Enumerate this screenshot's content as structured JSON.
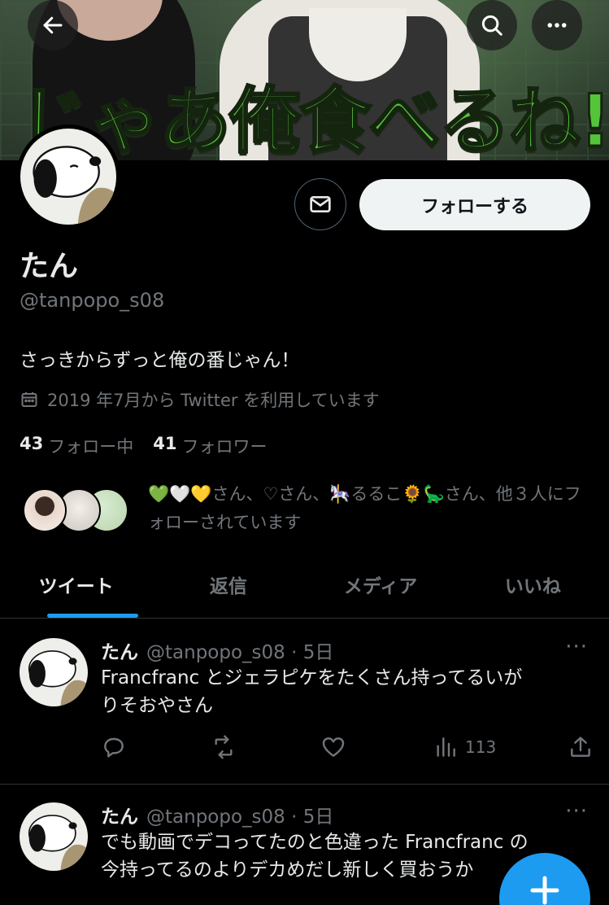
{
  "banner": {
    "caption": "じゃあ俺食べるね!"
  },
  "header_icons": {
    "back": "arrow-left-icon",
    "search": "search-icon",
    "more": "more-horizontal-icon"
  },
  "profile": {
    "display_name": "たん",
    "handle": "@tanpopo_s08",
    "bio": "さっきからずっと俺の番じゃん！",
    "joined": "2019 年7月から Twitter を利用しています",
    "follow_button": "フォローする",
    "following_count": "43",
    "following_label": "フォロー中",
    "followers_count": "41",
    "followers_label": "フォロワー",
    "followed_by_text": "💚🤍💛さん、♡さん、🎠るるこ🌻🦕さん、他３人にフォローされています"
  },
  "tabs": [
    {
      "label": "ツイート",
      "active": true
    },
    {
      "label": "返信",
      "active": false
    },
    {
      "label": "メディア",
      "active": false
    },
    {
      "label": "いいね",
      "active": false
    }
  ],
  "tweets": [
    {
      "name": "たん",
      "meta": "@tanpopo_s08 · 5日",
      "text_line1": "Francfranc とジェラピケをたくさん持ってるいが",
      "text_line2": "りそおやさん",
      "views": "113"
    },
    {
      "name": "たん",
      "meta": "@tanpopo_s08 · 5日",
      "text_line1": "でも動画でデコってたのと色違った Francfranc の",
      "text_line2": "今持ってるのよりデカめだし新しく買おうか"
    }
  ],
  "colors": {
    "accent": "#1d9bf0",
    "banner_text": "#55c43a",
    "muted": "#71767b",
    "text": "#e7e9ea",
    "background": "#000000"
  }
}
